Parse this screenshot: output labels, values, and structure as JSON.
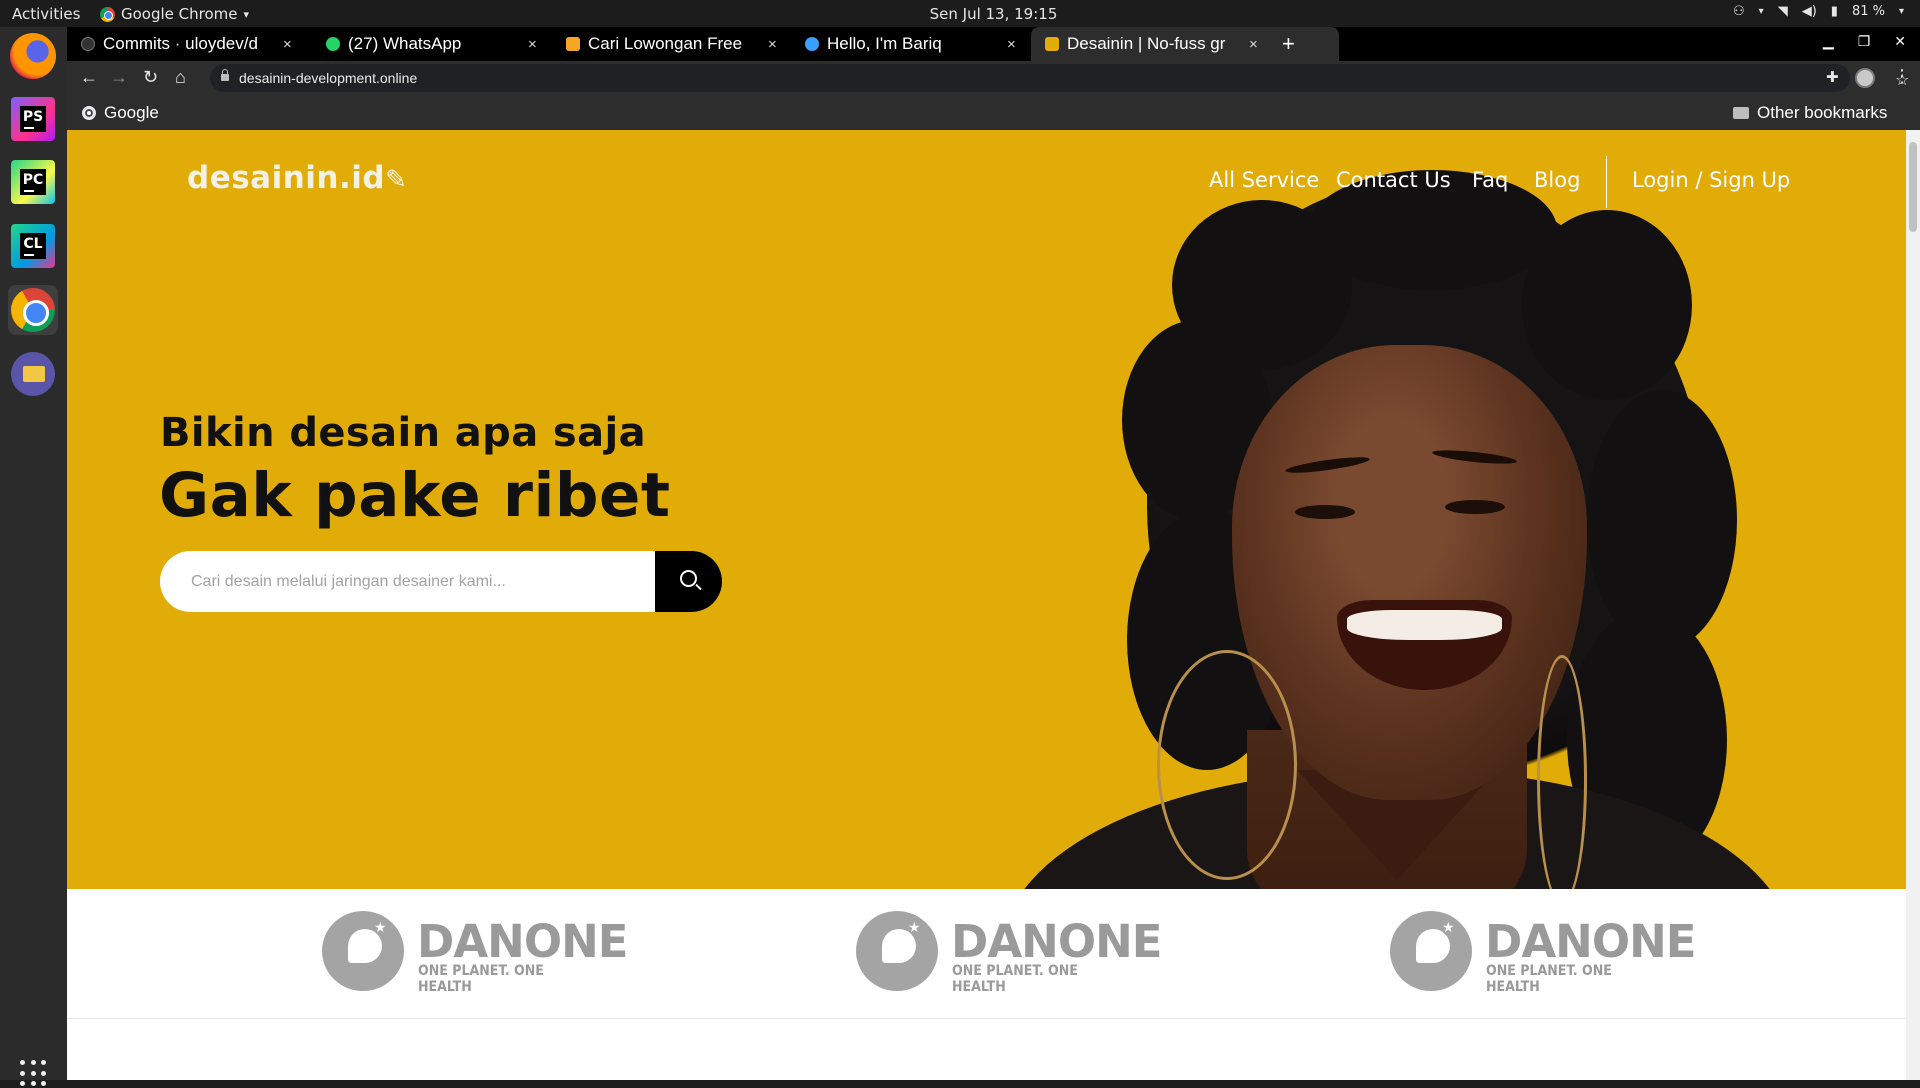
{
  "topbar": {
    "activities": "Activities",
    "app_name": "Google Chrome",
    "app_menu_arrow": "▾",
    "clock": "Sen Jul 13, 19:15",
    "battery": "81 %"
  },
  "dock": {
    "items": [
      "firefox-icon",
      "phpstorm-icon",
      "pycharm-icon",
      "clion-icon",
      "chrome-icon",
      "files-icon",
      "show-apps-icon"
    ],
    "phpstorm_label": "PS",
    "pycharm_label": "PC",
    "clion_label": "CL"
  },
  "browser": {
    "tabs": [
      {
        "title": "Commits · uloydev/d",
        "favicon_color": "#333333"
      },
      {
        "title": "(27) WhatsApp",
        "favicon_color": "#25d366"
      },
      {
        "title": "Cari Lowongan Free",
        "favicon_color": "#f5a623"
      },
      {
        "title": "Hello, I'm Bariq",
        "favicon_color": "#3aa0ff"
      },
      {
        "title": "Desainin | No-fuss gr",
        "favicon_color": "#e2ac08"
      }
    ],
    "tab_close": "×",
    "new_tab": "+",
    "url": "desainin-development.online",
    "bookmarks": {
      "left": "Google",
      "right": "Other bookmarks"
    }
  },
  "site": {
    "logo": "desainin.id",
    "nav": [
      "All Service",
      "Contact Us",
      "Faq",
      "Blog"
    ],
    "login": "Login / Sign Up",
    "hero_subtitle": "Bikin desain apa saja",
    "hero_title": "Gak pake ribet",
    "search_placeholder": "Cari desain melalui jaringan desainer kami...",
    "accent_color": "#e2ac08",
    "clients": [
      {
        "name": "DANONE",
        "tagline": "ONE PLANET. ONE HEALTH"
      },
      {
        "name": "DANONE",
        "tagline": "ONE PLANET. ONE HEALTH"
      },
      {
        "name": "DANONE",
        "tagline": "ONE PLANET. ONE HEALTH"
      }
    ]
  }
}
